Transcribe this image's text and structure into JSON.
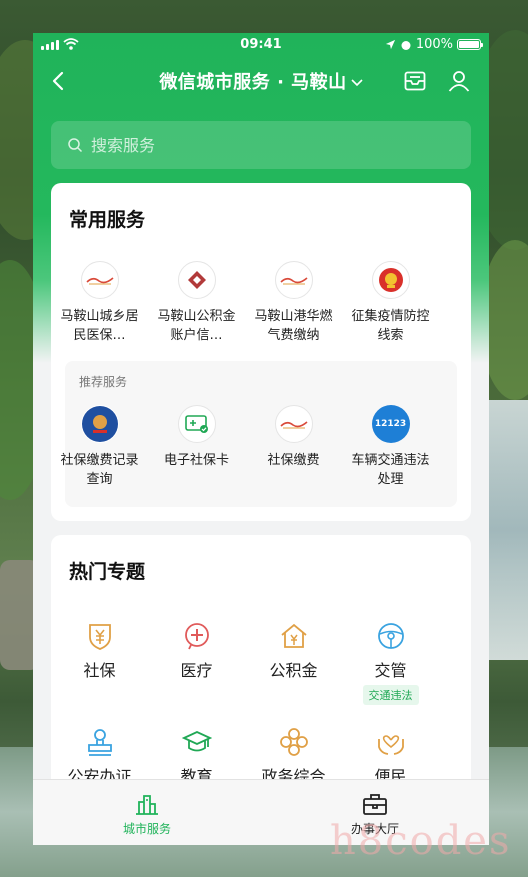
{
  "status_bar": {
    "time": "09:41",
    "battery": "100%"
  },
  "nav": {
    "title": "微信城市服务 · 马鞍山"
  },
  "search": {
    "placeholder": "搜索服务"
  },
  "common_services": {
    "title": "常用服务",
    "items": [
      {
        "label": "马鞍山城乡居民医保…",
        "icon": "ma-anshan-logo-icon"
      },
      {
        "label": "马鞍山公积金账户信…",
        "icon": "housing-fund-logo-icon"
      },
      {
        "label": "马鞍山港华燃气费缴纳",
        "icon": "ma-anshan-logo-icon"
      },
      {
        "label": "征集疫情防控线索",
        "icon": "national-emblem-icon"
      }
    ]
  },
  "recommended": {
    "title": "推荐服务",
    "items": [
      {
        "label": "社保缴费记录查询",
        "icon": "tax-bureau-icon"
      },
      {
        "label": "电子社保卡",
        "icon": "social-card-icon"
      },
      {
        "label": "社保缴费",
        "icon": "ma-anshan-logo-icon"
      },
      {
        "label": "车辆交通违法处理",
        "icon": "traffic-12123-icon",
        "badge_text": "12123"
      }
    ]
  },
  "hot_topics": {
    "title": "热门专题",
    "items": [
      {
        "label": "社保",
        "icon": "social-security-icon",
        "color": "#e0a046"
      },
      {
        "label": "医疗",
        "icon": "medical-icon",
        "color": "#e05a5a"
      },
      {
        "label": "公积金",
        "icon": "housing-icon",
        "color": "#e0a046"
      },
      {
        "label": "交管",
        "icon": "steering-wheel-icon",
        "color": "#3aa3e0",
        "tag": "交通违法"
      },
      {
        "label": "公安办证",
        "icon": "stamp-icon",
        "color": "#3aa3e0"
      },
      {
        "label": "教育",
        "icon": "graduation-cap-icon",
        "color": "#20a855"
      },
      {
        "label": "政务综合",
        "icon": "government-icon",
        "color": "#e0a046"
      },
      {
        "label": "便民",
        "icon": "hands-heart-icon",
        "color": "#e0a046"
      }
    ]
  },
  "tabbar": {
    "items": [
      {
        "label": "城市服务",
        "icon": "city-icon",
        "active": true
      },
      {
        "label": "办事大厅",
        "icon": "briefcase-icon",
        "active": false
      }
    ]
  },
  "watermark": {
    "text": "h8codes"
  },
  "colors": {
    "brand_green": "#20b35a",
    "background": "#f2f3f4"
  }
}
